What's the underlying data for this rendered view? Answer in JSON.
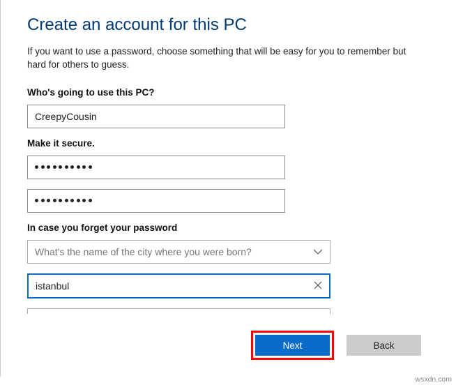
{
  "title": "Create an account for this PC",
  "description": "If you want to use a password, choose something that will be easy for you to remember but hard for others to guess.",
  "sections": {
    "who": {
      "label": "Who's going to use this PC?",
      "username": "CreepyCousin"
    },
    "secure": {
      "label": "Make it secure.",
      "password_dots": 10,
      "confirm_dots": 10
    },
    "forget": {
      "label": "In case you forget your password",
      "question_placeholder": "What's the name of the city where you were born?",
      "answer": "istanbul"
    }
  },
  "buttons": {
    "next": "Next",
    "back": "Back"
  },
  "attribution": "wsxdn.com"
}
